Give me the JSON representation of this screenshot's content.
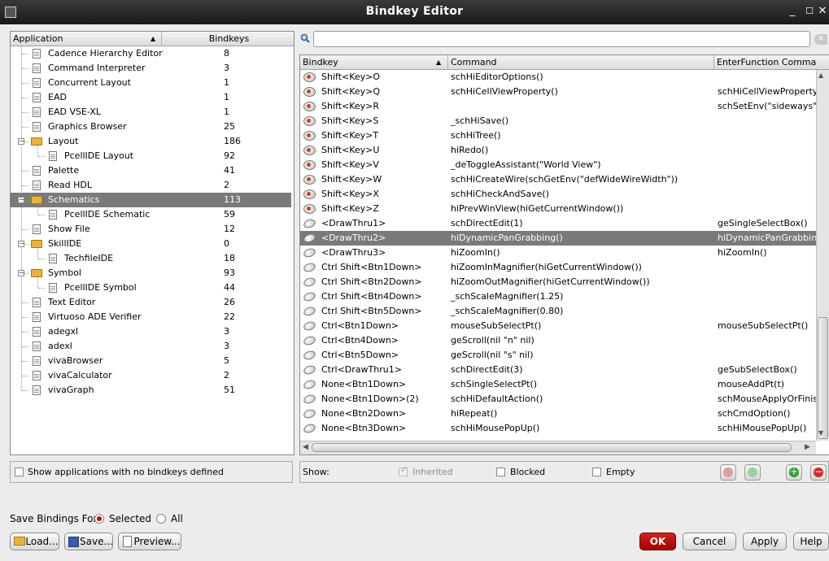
{
  "window": {
    "title": "Bindkey Editor"
  },
  "app_panel": {
    "col_application": "Application",
    "col_bindkeys": "Bindkeys",
    "items": [
      {
        "name": "Cadence Hierarchy Editor",
        "count": "8",
        "level": 1,
        "type": "doc"
      },
      {
        "name": "Command Interpreter",
        "count": "3",
        "level": 1,
        "type": "doc"
      },
      {
        "name": "Concurrent Layout",
        "count": "1",
        "level": 1,
        "type": "doc"
      },
      {
        "name": "EAD",
        "count": "1",
        "level": 1,
        "type": "doc"
      },
      {
        "name": "EAD VSE-XL",
        "count": "1",
        "level": 1,
        "type": "doc"
      },
      {
        "name": "Graphics Browser",
        "count": "25",
        "level": 1,
        "type": "doc"
      },
      {
        "name": "Layout",
        "count": "186",
        "level": 1,
        "type": "folder"
      },
      {
        "name": "PcellIDE Layout",
        "count": "92",
        "level": 2,
        "type": "doc"
      },
      {
        "name": "Palette",
        "count": "41",
        "level": 1,
        "type": "doc"
      },
      {
        "name": "Read HDL",
        "count": "2",
        "level": 1,
        "type": "doc"
      },
      {
        "name": "Schematics",
        "count": "113",
        "level": 1,
        "type": "folder",
        "selected": true
      },
      {
        "name": "PcellIDE Schematic",
        "count": "59",
        "level": 2,
        "type": "doc"
      },
      {
        "name": "Show File",
        "count": "12",
        "level": 1,
        "type": "doc"
      },
      {
        "name": "SkillIDE",
        "count": "0",
        "level": 1,
        "type": "folder"
      },
      {
        "name": "TechfileIDE",
        "count": "18",
        "level": 2,
        "type": "doc"
      },
      {
        "name": "Symbol",
        "count": "93",
        "level": 1,
        "type": "folder"
      },
      {
        "name": "PcellIDE Symbol",
        "count": "44",
        "level": 2,
        "type": "doc"
      },
      {
        "name": "Text Editor",
        "count": "26",
        "level": 1,
        "type": "doc"
      },
      {
        "name": "Virtuoso ADE Verifier",
        "count": "22",
        "level": 1,
        "type": "doc"
      },
      {
        "name": "adegxl",
        "count": "3",
        "level": 1,
        "type": "doc"
      },
      {
        "name": "adexl",
        "count": "3",
        "level": 1,
        "type": "doc"
      },
      {
        "name": "vivaBrowser",
        "count": "5",
        "level": 1,
        "type": "doc"
      },
      {
        "name": "vivaCalculator",
        "count": "2",
        "level": 1,
        "type": "doc"
      },
      {
        "name": "vivaGraph",
        "count": "51",
        "level": 1,
        "type": "doc"
      }
    ],
    "show_no_bindkeys_label": "Show applications with no bindkeys defined"
  },
  "search": {
    "placeholder": ""
  },
  "bindkey_table": {
    "col_bindkey": "Bindkey",
    "col_command": "Command",
    "col_enter": "EnterFunction Comma",
    "rows": [
      {
        "key": "Shift<Key>O",
        "command": "schHiEditorOptions()",
        "enter": "",
        "icon": "key"
      },
      {
        "key": "Shift<Key>Q",
        "command": "schHiCellViewProperty()",
        "enter": "schHiCellViewProperty",
        "icon": "key"
      },
      {
        "key": "Shift<Key>R",
        "command": "",
        "enter": "schSetEnv(\"sideways\" t",
        "icon": "key"
      },
      {
        "key": "Shift<Key>S",
        "command": "_schHiSave()",
        "enter": "",
        "icon": "key"
      },
      {
        "key": "Shift<Key>T",
        "command": "schHiTree()",
        "enter": "",
        "icon": "key"
      },
      {
        "key": "Shift<Key>U",
        "command": "hiRedo()",
        "enter": "",
        "icon": "key"
      },
      {
        "key": "Shift<Key>V",
        "command": "_deToggleAssistant(\"World View\")",
        "enter": "",
        "icon": "key"
      },
      {
        "key": "Shift<Key>W",
        "command": "schHiCreateWire(schGetEnv(\"defWideWireWidth\"))",
        "enter": "",
        "icon": "key"
      },
      {
        "key": "Shift<Key>X",
        "command": "schHiCheckAndSave()",
        "enter": "",
        "icon": "key"
      },
      {
        "key": "Shift<Key>Z",
        "command": "hiPrevWinView(hiGetCurrentWindow())",
        "enter": "",
        "icon": "key"
      },
      {
        "key": "<DrawThru1>",
        "command": "schDirectEdit(1)",
        "enter": "geSingleSelectBox()",
        "icon": "mouse"
      },
      {
        "key": "<DrawThru2>",
        "command": "hiDynamicPanGrabbing()",
        "enter": "hiDynamicPanGrabbin",
        "icon": "mouse",
        "selected": true
      },
      {
        "key": "<DrawThru3>",
        "command": "hiZoomIn()",
        "enter": "hiZoomIn()",
        "icon": "mouse"
      },
      {
        "key": "Ctrl Shift<Btn1Down>",
        "command": "hiZoomInMagnifier(hiGetCurrentWindow())",
        "enter": "",
        "icon": "mouse"
      },
      {
        "key": "Ctrl Shift<Btn2Down>",
        "command": "hiZoomOutMagnifier(hiGetCurrentWindow())",
        "enter": "",
        "icon": "mouse"
      },
      {
        "key": "Ctrl Shift<Btn4Down>",
        "command": "_schScaleMagnifier(1.25)",
        "enter": "",
        "icon": "mouse"
      },
      {
        "key": "Ctrl Shift<Btn5Down>",
        "command": "_schScaleMagnifier(0.80)",
        "enter": "",
        "icon": "mouse"
      },
      {
        "key": "Ctrl<Btn1Down>",
        "command": "mouseSubSelectPt()",
        "enter": "mouseSubSelectPt()",
        "icon": "mouse"
      },
      {
        "key": "Ctrl<Btn4Down>",
        "command": "geScroll(nil \"n\" nil)",
        "enter": "",
        "icon": "mouse"
      },
      {
        "key": "Ctrl<Btn5Down>",
        "command": "geScroll(nil \"s\" nil)",
        "enter": "",
        "icon": "mouse"
      },
      {
        "key": "Ctrl<DrawThru1>",
        "command": "schDirectEdit(3)",
        "enter": "geSubSelectBox()",
        "icon": "mouse"
      },
      {
        "key": "None<Btn1Down>",
        "command": "schSingleSelectPt()",
        "enter": "mouseAddPt(t)",
        "icon": "mouse"
      },
      {
        "key": "None<Btn1Down>(2)",
        "command": "schHiDefaultAction()",
        "enter": "schMouseApplyOrFinis",
        "icon": "mouse"
      },
      {
        "key": "None<Btn2Down>",
        "command": "hiRepeat()",
        "enter": "schCmdOption()",
        "icon": "mouse"
      },
      {
        "key": "None<Btn3Down>",
        "command": "schHiMousePopUp()",
        "enter": "schHiMousePopUp()",
        "icon": "mouse"
      }
    ]
  },
  "show_bar": {
    "show_label": "Show:",
    "inherited_label": "Inherited",
    "blocked_label": "Blocked",
    "empty_label": "Empty"
  },
  "save_bindings": {
    "label": "Save Bindings For:",
    "selected_label": "Selected",
    "all_label": "All"
  },
  "buttons": {
    "load": "Load...",
    "save": "Save...",
    "preview": "Preview...",
    "ok": "OK",
    "cancel": "Cancel",
    "apply": "Apply",
    "help": "Help"
  }
}
